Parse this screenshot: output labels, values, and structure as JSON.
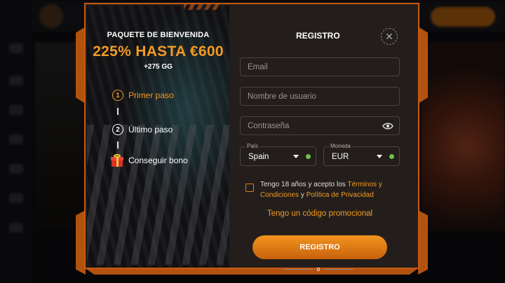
{
  "promo": {
    "title": "PAQUETE DE BIENVENIDA",
    "amount": "225% HASTA €600",
    "extra": "+275 GG",
    "steps": [
      {
        "number": "1",
        "label": "Primer paso"
      },
      {
        "number": "2",
        "label": "Último paso"
      },
      {
        "icon": "gift-icon",
        "label": "Conseguir bono"
      }
    ]
  },
  "form": {
    "title": "REGISTRO",
    "close_icon": "close-icon",
    "email_placeholder": "Email",
    "username_placeholder": "Nombre de usuario",
    "password_placeholder": "Contraseña",
    "country": {
      "label": "País",
      "value": "Spain"
    },
    "currency": {
      "label": "Moneda",
      "value": "EUR"
    },
    "terms": {
      "prefix": "Tengo 18 años y acepto los",
      "terms_link": "Términos y Condiciones",
      "conjunction": "y",
      "privacy_link": "Política de Privacidad"
    },
    "promo_code_link": "Tengo un código promocional",
    "submit_label": "REGISTRO"
  },
  "colors": {
    "accent": "#f29a24",
    "frame": "#c75a14",
    "valid": "#6cc24a"
  }
}
